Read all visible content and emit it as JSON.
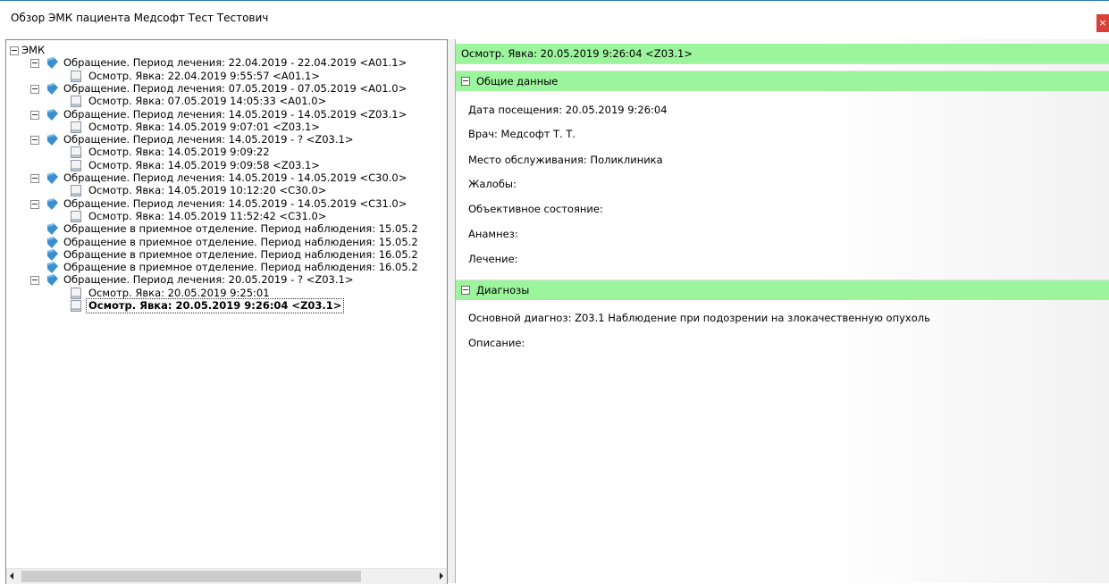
{
  "window": {
    "title": "Обзор ЭМК пациента Медсофт Тест Тестович",
    "close_label": "×"
  },
  "tree": {
    "root_label": "ЭМК",
    "nodes": [
      {
        "type": "folder",
        "label": "Обращение. Период лечения: 22.04.2019 - 22.04.2019 <A01.1>"
      },
      {
        "type": "doc",
        "label": "Осмотр. Явка: 22.04.2019 9:55:57 <A01.1>"
      },
      {
        "type": "folder",
        "label": "Обращение. Период лечения: 07.05.2019 - 07.05.2019 <A01.0>"
      },
      {
        "type": "doc",
        "label": "Осмотр. Явка: 07.05.2019 14:05:33 <A01.0>"
      },
      {
        "type": "folder",
        "label": "Обращение. Период лечения: 14.05.2019 - 14.05.2019 <Z03.1>"
      },
      {
        "type": "doc",
        "label": "Осмотр. Явка: 14.05.2019 9:07:01 <Z03.1>"
      },
      {
        "type": "folder",
        "label": "Обращение. Период лечения: 14.05.2019 - ? <Z03.1>"
      },
      {
        "type": "doc",
        "label": "Осмотр. Явка: 14.05.2019 9:09:22"
      },
      {
        "type": "doc",
        "label": "Осмотр. Явка: 14.05.2019 9:09:58 <Z03.1>"
      },
      {
        "type": "folder",
        "label": "Обращение. Период лечения: 14.05.2019 - 14.05.2019 <C30.0>"
      },
      {
        "type": "doc",
        "label": "Осмотр. Явка: 14.05.2019 10:12:20 <C30.0>"
      },
      {
        "type": "folder",
        "label": "Обращение. Период лечения: 14.05.2019 - 14.05.2019 <C31.0>"
      },
      {
        "type": "doc",
        "label": "Осмотр. Явка: 14.05.2019 11:52:42 <C31.0>"
      },
      {
        "type": "leaf-folder",
        "label": "Обращение в приемное отделение. Период наблюдения: 15.05.2"
      },
      {
        "type": "leaf-folder",
        "label": "Обращение в приемное отделение. Период наблюдения: 15.05.2"
      },
      {
        "type": "leaf-folder",
        "label": "Обращение в приемное отделение. Период наблюдения: 16.05.2"
      },
      {
        "type": "leaf-folder",
        "label": "Обращение в приемное отделение. Период наблюдения: 16.05.2"
      },
      {
        "type": "folder",
        "label": "Обращение. Период лечения: 20.05.2019 - ? <Z03.1>"
      },
      {
        "type": "doc",
        "label": "Осмотр. Явка: 20.05.2019 9:25:01"
      },
      {
        "type": "doc",
        "label": "Осмотр. Явка: 20.05.2019 9:26:04 <Z03.1>",
        "selected": true
      }
    ]
  },
  "detail": {
    "header": "Осмотр. Явка: 20.05.2019 9:26:04 <Z03.1>",
    "general_section": "Общие данные",
    "visit_date": "Дата посещения: 20.05.2019 9:26:04",
    "doctor": "Врач: Медсофт Т. Т.",
    "place": "Место обслуживания: Поликлиника",
    "complaints": "Жалобы:",
    "objective": "Объективное состояние:",
    "anamnesis": "Анамнез:",
    "treatment": "Лечение:",
    "diagnoses_section": "Диагнозы",
    "main_diagnosis": "Основной диагноз: Z03.1 Наблюдение при подозрении на злокачественную опухоль",
    "description": "Описание:"
  },
  "colors": {
    "section_header": "#9cf59c",
    "folder_icon": "#3a8fd0",
    "close_button": "#d9403a"
  }
}
